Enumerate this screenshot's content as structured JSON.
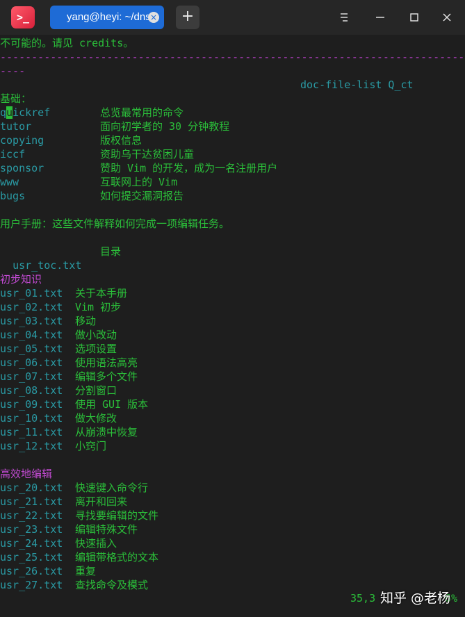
{
  "window": {
    "tab_title": "yang@heyi: ~/dns",
    "tab_close": "×",
    "add_tab": "+",
    "app_icon": ">_"
  },
  "terminal": {
    "line_intro": "不可能的。请见 credits。",
    "separator": "----------------------------------------------------------------------------",
    "separator_wrap": "----",
    "tag_line": "doc-file-list Q_ct",
    "basics_heading": "基础：",
    "basics_cursor_first": "q",
    "basics_cursor_char": "u",
    "basics": [
      {
        "name": "ickref",
        "desc": "总览最常用的命令"
      },
      {
        "name": "tutor",
        "desc": "面向初学者的 30 分钟教程"
      },
      {
        "name": "copying",
        "desc": "版权信息"
      },
      {
        "name": "iccf",
        "desc": "资助乌干达贫困儿童"
      },
      {
        "name": "sponsor",
        "desc": "赞助 Vim 的开发，成为一名注册用户"
      },
      {
        "name": "www",
        "desc": "互联网上的 Vim"
      },
      {
        "name": "bugs",
        "desc": "如何提交漏洞报告"
      }
    ],
    "manual_heading": "用户手册：这些文件解释如何完成一项编辑任务。",
    "toc": {
      "name": "usr_toc.txt",
      "desc": "目录"
    },
    "section1_heading": "初步知识",
    "section1": [
      {
        "name": "usr_01.txt",
        "desc": "关于本手册"
      },
      {
        "name": "usr_02.txt",
        "desc": "Vim 初步"
      },
      {
        "name": "usr_03.txt",
        "desc": "移动"
      },
      {
        "name": "usr_04.txt",
        "desc": "做小改动"
      },
      {
        "name": "usr_05.txt",
        "desc": "选项设置"
      },
      {
        "name": "usr_06.txt",
        "desc": "使用语法高亮"
      },
      {
        "name": "usr_07.txt",
        "desc": "编辑多个文件"
      },
      {
        "name": "usr_08.txt",
        "desc": "分割窗口"
      },
      {
        "name": "usr_09.txt",
        "desc": "使用 GUI 版本"
      },
      {
        "name": "usr_10.txt",
        "desc": "做大修改"
      },
      {
        "name": "usr_11.txt",
        "desc": "从崩溃中恢复"
      },
      {
        "name": "usr_12.txt",
        "desc": "小窍门"
      }
    ],
    "section2_heading": "高效地编辑",
    "section2": [
      {
        "name": "usr_20.txt",
        "desc": "快速键入命令行"
      },
      {
        "name": "usr_21.txt",
        "desc": "离开和回来"
      },
      {
        "name": "usr_22.txt",
        "desc": "寻找要编辑的文件"
      },
      {
        "name": "usr_23.txt",
        "desc": "编辑特殊文件"
      },
      {
        "name": "usr_24.txt",
        "desc": "快速插入"
      },
      {
        "name": "usr_25.txt",
        "desc": "编辑带格式的文本"
      },
      {
        "name": "usr_26.txt",
        "desc": "重复"
      },
      {
        "name": "usr_27.txt",
        "desc": "查找命令及模式"
      }
    ],
    "status_position": "35,3",
    "status_percent": "6%"
  },
  "watermark": "知乎 @老杨",
  "colors": {
    "green": "#2bbf3a",
    "cyan": "#2a9aa4",
    "magenta": "#c04ad0",
    "tab_blue": "#1e6bd6"
  },
  "icons": [
    "terminal-app-icon",
    "close-icon",
    "plus-icon",
    "menu-icon",
    "minimize-icon",
    "maximize-icon",
    "window-close-icon"
  ]
}
